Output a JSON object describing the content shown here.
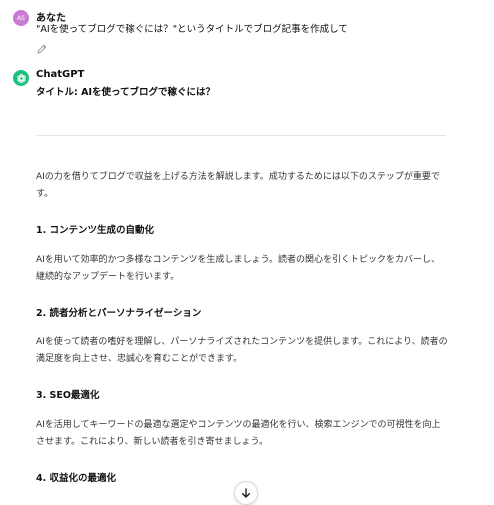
{
  "colors": {
    "user_avatar_bg": "#c97ad2",
    "gpt_avatar_bg": "#19c37d",
    "text": "#0d0d0d",
    "divider": "#e5e5e5"
  },
  "user": {
    "avatar_text": "AS",
    "name": "あなた",
    "message": "\"AIを使ってブログで稼ぐには？\"というタイトルでブログ記事を作成して",
    "edit_icon": "pencil-icon"
  },
  "assistant": {
    "avatar_icon": "openai-logo-icon",
    "name": "ChatGPT",
    "title_line": "タイトル: AIを使ってブログで稼ぐには？",
    "intro": "AIの力を借りてブログで収益を上げる方法を解説します。成功するためには以下のステップが重要です。",
    "sections": [
      {
        "heading": "1. コンテンツ生成の自動化",
        "body": "AIを用いて効率的かつ多様なコンテンツを生成しましょう。読者の関心を引くトピックをカバーし、継続的なアップデートを行います。"
      },
      {
        "heading": "2. 読者分析とパーソナライゼーション",
        "body": "AIを使って読者の嗜好を理解し、パーソナライズされたコンテンツを提供します。これにより、読者の満足度を向上させ、忠誠心を育むことができます。"
      },
      {
        "heading": "3. SEO最適化",
        "body": "AIを活用してキーワードの最適な選定やコンテンツの最適化を行い、検索エンジンでの可視性を向上させます。これにより、新しい読者を引き寄せましょう。"
      },
      {
        "heading": "4. 収益化の最適化",
        "body": ""
      }
    ]
  },
  "scroll_button": {
    "icon": "arrow-down-icon"
  }
}
